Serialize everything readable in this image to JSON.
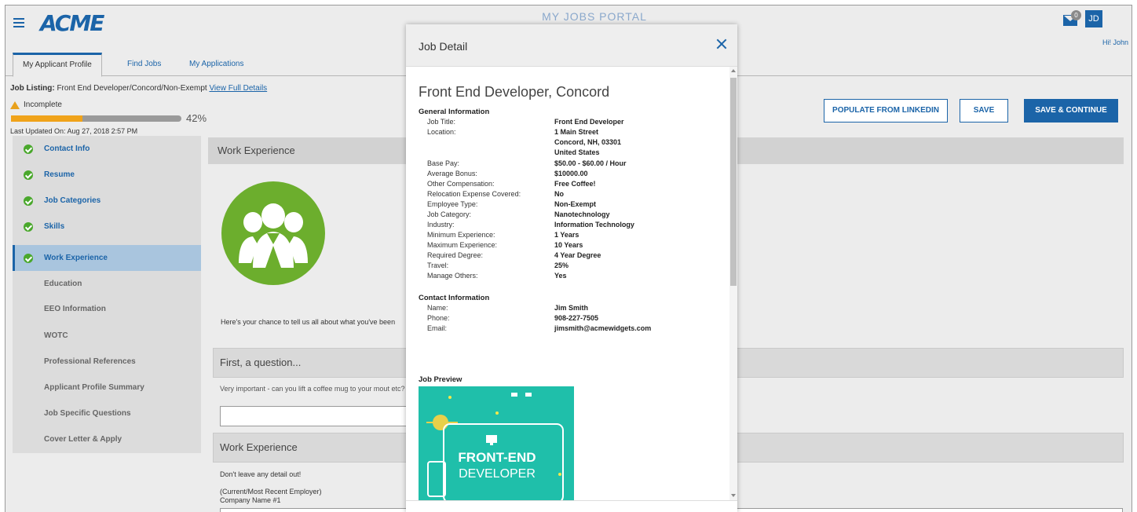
{
  "header": {
    "logo_text": "ACME",
    "portal_title": "MY JOBS PORTAL",
    "mail_badge": "0",
    "avatar_initials": "JD",
    "greeting": "Hi! John"
  },
  "tabs": [
    {
      "label": "My Applicant Profile"
    },
    {
      "label": "Find Jobs"
    },
    {
      "label": "My Applications"
    }
  ],
  "listing": {
    "prefix": "Job Listing:",
    "text": "Front End Developer/Concord/Non-Exempt",
    "link": "View Full Details",
    "status": "Incomplete",
    "progress_percent": 42,
    "progress_label": "42%",
    "last_updated": "Last Updated On: Aug 27, 2018 2:57 PM"
  },
  "actions": {
    "linkedin": "POPULATE FROM LINKEDIN",
    "save": "SAVE",
    "save_continue": "SAVE & CONTINUE"
  },
  "sidebar": {
    "items": [
      {
        "label": "Contact Info",
        "state": "done"
      },
      {
        "label": "Resume",
        "state": "done"
      },
      {
        "label": "Job Categories",
        "state": "done"
      },
      {
        "label": "Skills",
        "state": "done"
      },
      {
        "label": "Work Experience",
        "state": "active"
      },
      {
        "label": "Education",
        "state": "todo"
      },
      {
        "label": "EEO Information",
        "state": "todo"
      },
      {
        "label": "WOTC",
        "state": "todo"
      },
      {
        "label": "Professional References",
        "state": "todo"
      },
      {
        "label": "Applicant Profile Summary",
        "state": "todo"
      },
      {
        "label": "Job Specific Questions",
        "state": "todo"
      },
      {
        "label": "Cover Letter & Apply",
        "state": "todo"
      }
    ]
  },
  "main": {
    "section_title": "Work Experience",
    "intro": "Here's your chance to tell us all about what you've been",
    "question_title": "First, a question...",
    "question_text": "Very important - can you lift a coffee mug to your mout etc?",
    "work_title": "Work Experience",
    "detail_hint": "Don't leave any detail out!",
    "employer_hint": "(Current/Most Recent Employer)",
    "company_label": "Company Name #1"
  },
  "modal": {
    "title": "Job Detail",
    "heading": "Front End Developer, Concord",
    "general_title": "General Information",
    "general": [
      {
        "label": "Job Title:",
        "value": "Front End Developer"
      },
      {
        "label": "Location:",
        "value": "1 Main Street"
      },
      {
        "label": "",
        "value": "Concord, NH, 03301"
      },
      {
        "label": "",
        "value": "United States"
      },
      {
        "label": "Base Pay:",
        "value": "$50.00 - $60.00 / Hour"
      },
      {
        "label": "Average Bonus:",
        "value": "$10000.00"
      },
      {
        "label": "Other Compensation:",
        "value": "Free Coffee!"
      },
      {
        "label": "Relocation Expense Covered:",
        "value": "No"
      },
      {
        "label": "Employee Type:",
        "value": "Non-Exempt"
      },
      {
        "label": "Job Category:",
        "value": "Nanotechnology"
      },
      {
        "label": "Industry:",
        "value": "Information Technology"
      },
      {
        "label": "Minimum Experience:",
        "value": "1 Years"
      },
      {
        "label": "Maximum Experience:",
        "value": "10 Years"
      },
      {
        "label": "Required Degree:",
        "value": "4 Year Degree"
      },
      {
        "label": "Travel:",
        "value": "25%"
      },
      {
        "label": "Manage Others:",
        "value": "Yes"
      }
    ],
    "contact_title": "Contact Information",
    "contact": [
      {
        "label": "Name:",
        "value": "Jim Smith"
      },
      {
        "label": "Phone:",
        "value": "908-227-7505"
      },
      {
        "label": "Email:",
        "value": "jimsmith@acmewidgets.com"
      }
    ],
    "preview_title": "Job Preview",
    "preview_line1": "FRONT-END",
    "preview_line2": "DEVELOPER"
  },
  "colors": {
    "brand": "#1b64a8",
    "progress": "#f0a31a",
    "success": "#4aa82c",
    "preview_bg": "#1fbfaa"
  }
}
